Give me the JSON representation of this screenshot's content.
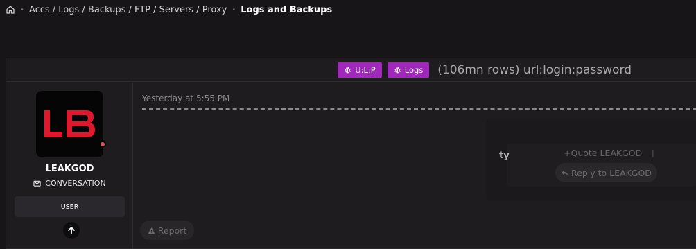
{
  "breadcrumb": {
    "items": [
      "Accs / Logs / Backups / FTP / Servers / Proxy"
    ],
    "current": "Logs and Backups"
  },
  "thread": {
    "tags": [
      "U:L:P",
      "Logs"
    ],
    "title": "(106mn rows) url:login:password"
  },
  "user": {
    "name": "LEAKGOD",
    "conversation": "CONVERSATION",
    "role": "USER",
    "avatar_text": "LB"
  },
  "post": {
    "date": "Yesterday at 5:55 PM",
    "body_fragment": "ty",
    "quote": "Quote LEAKGOD",
    "reply": "Reply to LEAKGOD",
    "report": "Report"
  },
  "colors": {
    "tag_bg": "#a228bd",
    "avatar_accent": "#e0182d",
    "online_dot": "#e05560"
  }
}
